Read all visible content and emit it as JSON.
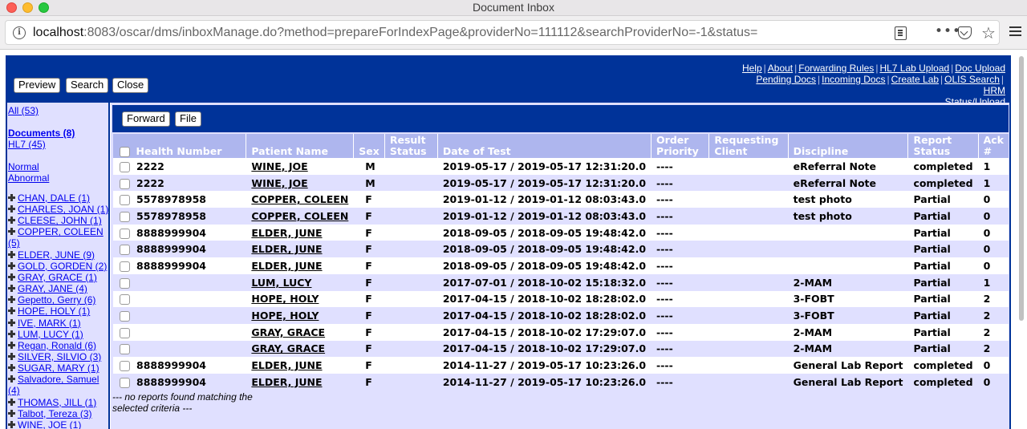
{
  "window": {
    "title": "Document Inbox"
  },
  "address": {
    "host": "localhost",
    "rest": ":8083/oscar/dms/inboxManage.do?method=prepareForIndexPage&providerNo=111112&searchProviderNo=-1&status="
  },
  "toolbar": {
    "preview": "Preview",
    "search": "Search",
    "close": "Close"
  },
  "top_links": [
    {
      "label": "Help"
    },
    {
      "label": "About"
    },
    {
      "label": "Forwarding Rules"
    },
    {
      "label": "HL7 Lab Upload"
    },
    {
      "label": "Doc Upload"
    },
    {
      "label": "Pending Docs"
    },
    {
      "label": "Incoming Docs"
    },
    {
      "label": "Create Lab"
    },
    {
      "label": "OLIS Search"
    },
    {
      "label": "HRM Status/Upload"
    }
  ],
  "sidebar": {
    "all": "All (53)",
    "documents": "Documents (8)",
    "hl7": "HL7 (45)",
    "normal": "Normal",
    "abnormal": "Abnormal",
    "patients": [
      "CHAN, DALE (1)",
      "CHARLES, JOAN (1)",
      "CLEESE, JOHN (1)",
      "COPPER, COLEEN (5)",
      "ELDER, JUNE (9)",
      "GOLD, GORDEN (2)",
      "GRAY, GRACE (1)",
      "GRAY, JANE (4)",
      "Gepetto, Gerry (6)",
      "HOPE, HOLY (1)",
      "IVE, MARK (1)",
      "LUM, LUCY (1)",
      "Regan, Ronald (6)",
      "SILVER, SILVIO (3)",
      "SUGAR, MARY (1)",
      "Salvadore, Samuel (4)",
      "THOMAS, JILL (1)",
      "Talbot, Tereza (3)",
      "WINE, JOE (1)"
    ]
  },
  "actions": {
    "forward": "Forward",
    "file": "File"
  },
  "table": {
    "headers": [
      "Health Number",
      "Patient Name",
      "Sex",
      "Result Status",
      "Date of Test",
      "Order Priority",
      "Requesting Client",
      "Discipline",
      "Report Status",
      "Ack #"
    ],
    "rows": [
      [
        "2222",
        "WINE, JOE",
        "M",
        "",
        "2019-05-17 / 2019-05-17 12:31:20.0",
        "----",
        "",
        "eReferral Note",
        "completed",
        "1"
      ],
      [
        "2222",
        "WINE, JOE",
        "M",
        "",
        "2019-05-17 / 2019-05-17 12:31:20.0",
        "----",
        "",
        "eReferral Note",
        "completed",
        "1"
      ],
      [
        "5578978958",
        "COPPER, COLEEN",
        "F",
        "",
        "2019-01-12 / 2019-01-12 08:03:43.0",
        "----",
        "",
        "test photo",
        "Partial",
        "0"
      ],
      [
        "5578978958",
        "COPPER, COLEEN",
        "F",
        "",
        "2019-01-12 / 2019-01-12 08:03:43.0",
        "----",
        "",
        "test photo",
        "Partial",
        "0"
      ],
      [
        "8888999904",
        "ELDER, JUNE",
        "F",
        "",
        "2018-09-05 / 2018-09-05 19:48:42.0",
        "----",
        "",
        "",
        "Partial",
        "0"
      ],
      [
        "8888999904",
        "ELDER, JUNE",
        "F",
        "",
        "2018-09-05 / 2018-09-05 19:48:42.0",
        "----",
        "",
        "",
        "Partial",
        "0"
      ],
      [
        "8888999904",
        "ELDER, JUNE",
        "F",
        "",
        "2018-09-05 / 2018-09-05 19:48:42.0",
        "----",
        "",
        "",
        "Partial",
        "0"
      ],
      [
        "",
        "LUM, LUCY",
        "F",
        "",
        "2017-07-01 / 2018-10-02 15:18:32.0",
        "----",
        "",
        "2-MAM",
        "Partial",
        "1"
      ],
      [
        "",
        "HOPE, HOLY",
        "F",
        "",
        "2017-04-15 / 2018-10-02 18:28:02.0",
        "----",
        "",
        "3-FOBT",
        "Partial",
        "2"
      ],
      [
        "",
        "HOPE, HOLY",
        "F",
        "",
        "2017-04-15 / 2018-10-02 18:28:02.0",
        "----",
        "",
        "3-FOBT",
        "Partial",
        "2"
      ],
      [
        "",
        "GRAY, GRACE",
        "F",
        "",
        "2017-04-15 / 2018-10-02 17:29:07.0",
        "----",
        "",
        "2-MAM",
        "Partial",
        "2"
      ],
      [
        "",
        "GRAY, GRACE",
        "F",
        "",
        "2017-04-15 / 2018-10-02 17:29:07.0",
        "----",
        "",
        "2-MAM",
        "Partial",
        "2"
      ],
      [
        "8888999904",
        "ELDER, JUNE",
        "F",
        "",
        "2014-11-27 / 2019-05-17 10:23:26.0",
        "----",
        "",
        "General Lab Report",
        "completed",
        "0"
      ],
      [
        "8888999904",
        "ELDER, JUNE",
        "F",
        "",
        "2014-11-27 / 2019-05-17 10:23:26.0",
        "----",
        "",
        "General Lab Report",
        "completed",
        "0"
      ]
    ]
  },
  "no_reports": "--- no reports found matching the selected criteria ---"
}
